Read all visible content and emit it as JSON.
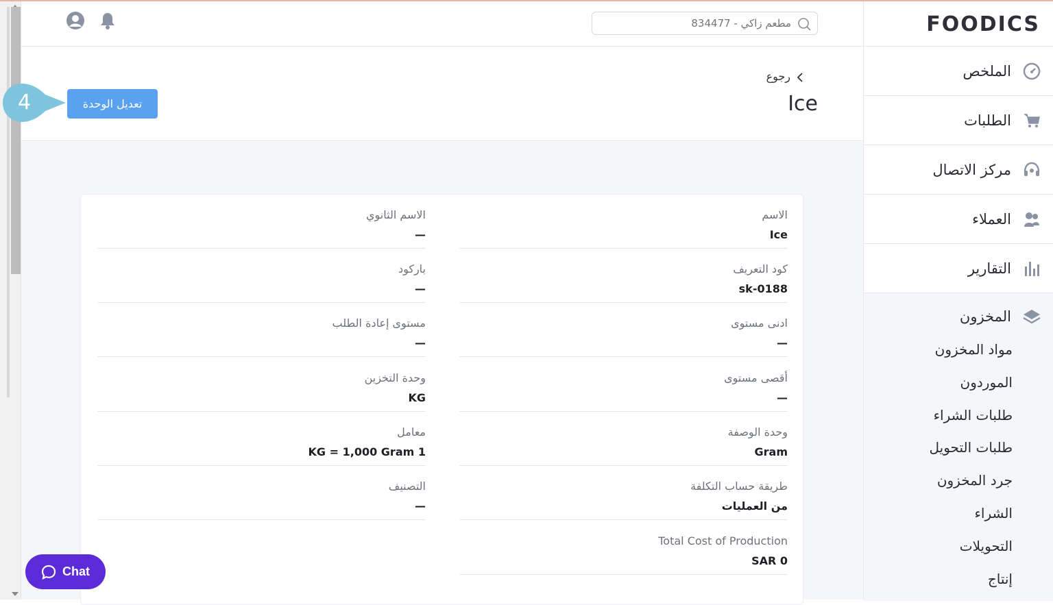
{
  "app": {
    "logo_text": "FOODICS"
  },
  "topbar": {
    "search_placeholder": "مطعم زاكي - 834477",
    "user_icon": "user-circle-icon",
    "bell_icon": "bell-icon"
  },
  "sidebar": {
    "items": [
      {
        "label": "الملخص",
        "icon": "dashboard-gauge-icon"
      },
      {
        "label": "الطلبات",
        "icon": "cart-icon"
      },
      {
        "label": "مركز الاتصال",
        "icon": "headset-icon"
      },
      {
        "label": "العملاء",
        "icon": "customers-icon"
      },
      {
        "label": "التقارير",
        "icon": "bar-chart-icon"
      }
    ],
    "inventory": {
      "label": "المخزون",
      "icon": "layers-icon",
      "sub_items": [
        "مواد المخزون",
        "الموردون",
        "طلبات الشراء",
        "طلبات التحويل",
        "جرد المخزون",
        "الشراء",
        "التحويلات",
        "إنتاج"
      ]
    }
  },
  "page": {
    "back_label": "رجوع",
    "title": "Ice",
    "edit_button": "تعديل الوحدة",
    "step_number": "4"
  },
  "details": {
    "right": [
      {
        "label": "الاسم",
        "value": "Ice"
      },
      {
        "label": "كود التعريف",
        "value": "sk-0188"
      },
      {
        "label": "ادنى مستوى",
        "value": "—"
      },
      {
        "label": "أقصى مستوى",
        "value": "—"
      },
      {
        "label": "وحدة الوصفة",
        "value": "Gram"
      },
      {
        "label": "طريقة حساب التكلفة",
        "value": "من العمليات"
      },
      {
        "label": "Total Cost of Production",
        "value": "SAR 0"
      }
    ],
    "left": [
      {
        "label": "الاسم الثانوي",
        "value": "—"
      },
      {
        "label": "باركود",
        "value": "—"
      },
      {
        "label": "مستوى إعادة الطلب",
        "value": "—"
      },
      {
        "label": "وحدة التخزين",
        "value": "KG"
      },
      {
        "label": "معامل",
        "value": "1 KG = 1,000 Gram"
      },
      {
        "label": "التصنيف",
        "value": "—"
      }
    ]
  },
  "chat": {
    "label": "Chat"
  },
  "colors": {
    "primary": "#5aa2f0",
    "chat": "#5b2bd8",
    "marker": "#7ec4dc"
  }
}
